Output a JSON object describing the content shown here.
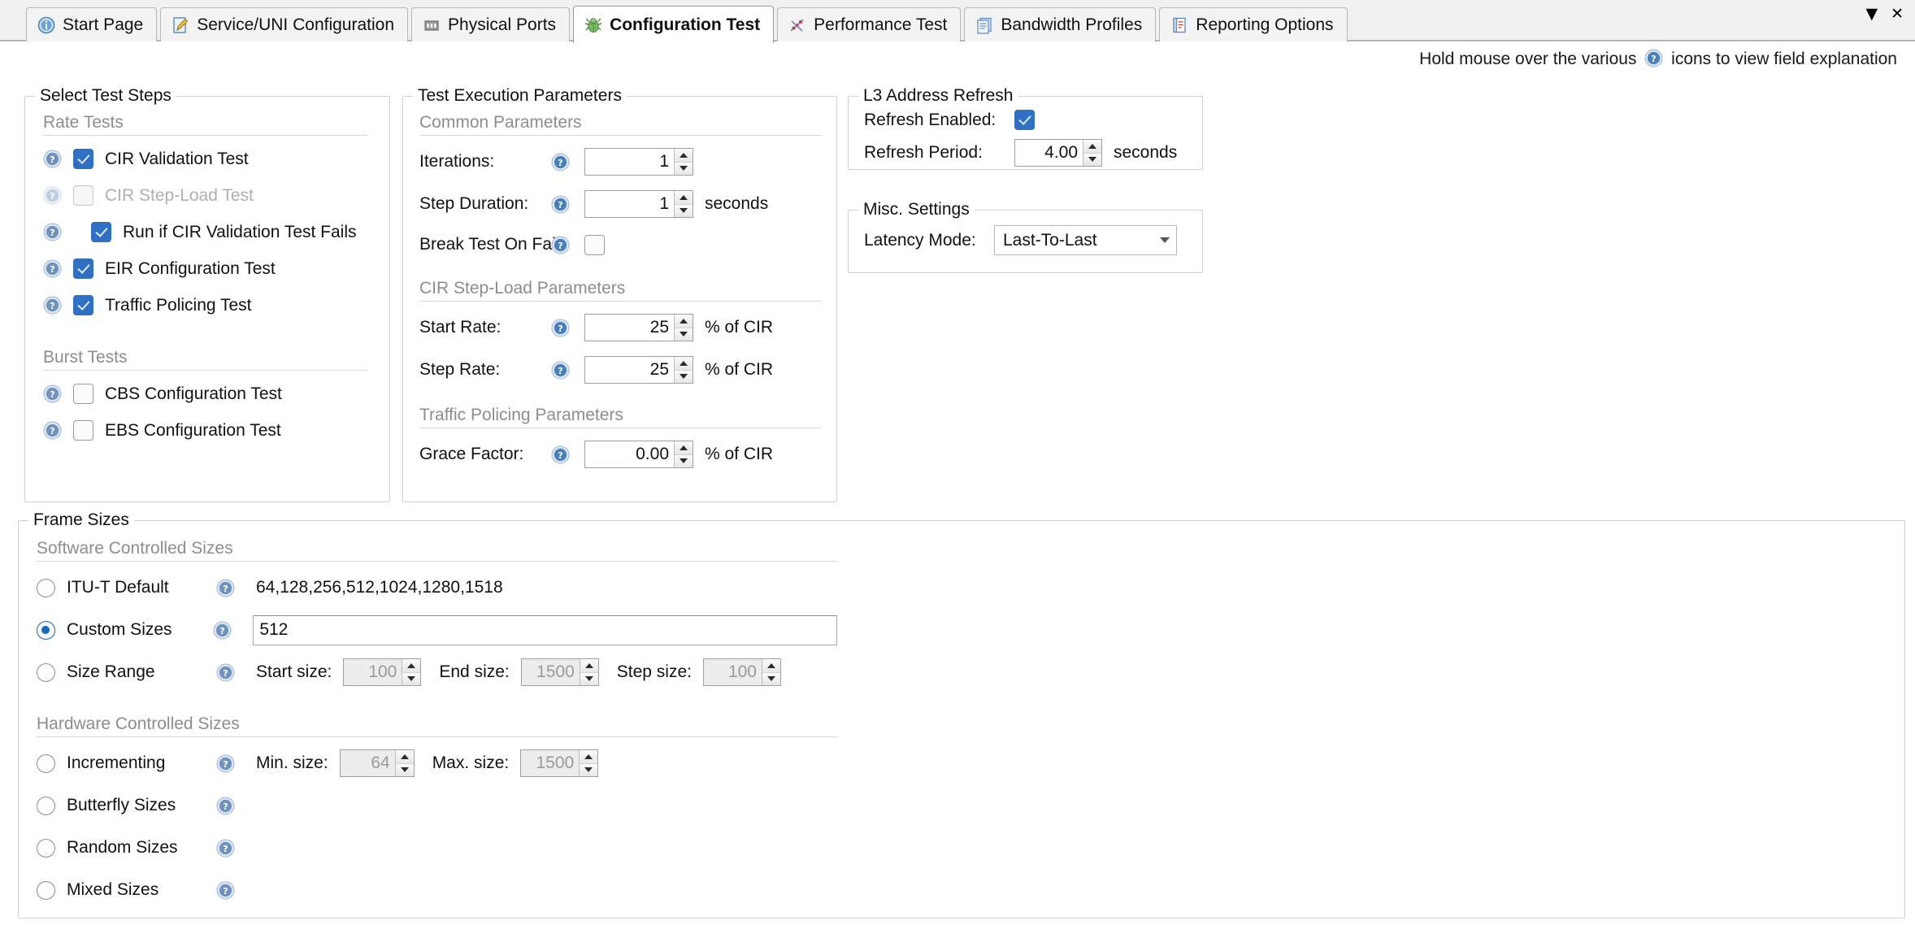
{
  "tabs": [
    {
      "label": "Start Page",
      "icon": "info-icon",
      "active": false
    },
    {
      "label": "Service/UNI Configuration",
      "icon": "pencil-document-icon",
      "active": false
    },
    {
      "label": "Physical Ports",
      "icon": "ports-icon",
      "active": false
    },
    {
      "label": "Configuration Test",
      "icon": "green-bug-icon",
      "active": true
    },
    {
      "label": "Performance Test",
      "icon": "scatter-chart-icon",
      "active": false
    },
    {
      "label": "Bandwidth Profiles",
      "icon": "documents-icon",
      "active": false
    },
    {
      "label": "Reporting Options",
      "icon": "report-icon",
      "active": false
    }
  ],
  "window_buttons": {
    "dropdown": "▼",
    "close": "✕"
  },
  "hint": {
    "before": "Hold mouse over the various",
    "after": "icons to view field explanation"
  },
  "select_test_steps": {
    "title": "Select Test Steps",
    "rate_tests_header": "Rate Tests",
    "burst_tests_header": "Burst Tests",
    "rate_tests": [
      {
        "label": "CIR Validation Test",
        "checked": true,
        "disabled": false,
        "indent": false
      },
      {
        "label": "CIR Step-Load Test",
        "checked": false,
        "disabled": true,
        "indent": false
      },
      {
        "label": "Run if CIR Validation Test Fails",
        "checked": true,
        "disabled": false,
        "indent": true
      },
      {
        "label": "EIR Configuration Test",
        "checked": true,
        "disabled": false,
        "indent": false
      },
      {
        "label": "Traffic Policing Test",
        "checked": true,
        "disabled": false,
        "indent": false
      }
    ],
    "burst_tests": [
      {
        "label": "CBS Configuration Test",
        "checked": false,
        "disabled": false,
        "indent": false
      },
      {
        "label": "EBS Configuration Test",
        "checked": false,
        "disabled": false,
        "indent": false
      }
    ]
  },
  "test_execution": {
    "title": "Test Execution Parameters",
    "common_header": "Common Parameters",
    "iterations": {
      "label": "Iterations:",
      "value": "1"
    },
    "step_duration": {
      "label": "Step Duration:",
      "value": "1",
      "units": "seconds"
    },
    "break_on_fail": {
      "label": "Break Test On Fail:",
      "checked": false
    },
    "cir_step_load_header": "CIR Step-Load Parameters",
    "start_rate": {
      "label": "Start Rate:",
      "value": "25",
      "units": "% of CIR"
    },
    "step_rate": {
      "label": "Step Rate:",
      "value": "25",
      "units": "% of CIR"
    },
    "traffic_policing_header": "Traffic Policing Parameters",
    "grace_factor": {
      "label": "Grace Factor:",
      "value": "0.00",
      "units": "% of CIR"
    }
  },
  "l3_refresh": {
    "title": "L3 Address Refresh",
    "refresh_enabled": {
      "label": "Refresh Enabled:",
      "checked": true
    },
    "refresh_period": {
      "label": "Refresh Period:",
      "value": "4.00",
      "units": "seconds"
    }
  },
  "misc_settings": {
    "title": "Misc. Settings",
    "latency_mode": {
      "label": "Latency Mode:",
      "value": "Last-To-Last"
    }
  },
  "frame_sizes": {
    "title": "Frame Sizes",
    "software_header": "Software Controlled Sizes",
    "hardware_header": "Hardware Controlled Sizes",
    "itut_default": {
      "label": "ITU-T Default",
      "selected": false,
      "values": "64,128,256,512,1024,1280,1518"
    },
    "custom_sizes": {
      "label": "Custom Sizes",
      "selected": true,
      "value": "512"
    },
    "size_range": {
      "label": "Size Range",
      "selected": false,
      "start_label": "Start size:",
      "start_value": "100",
      "end_label": "End size:",
      "end_value": "1500",
      "step_label": "Step size:",
      "step_value": "100"
    },
    "incrementing": {
      "label": "Incrementing",
      "selected": false,
      "min_label": "Min. size:",
      "min_value": "64",
      "max_label": "Max. size:",
      "max_value": "1500"
    },
    "butterfly": {
      "label": "Butterfly Sizes",
      "selected": false
    },
    "random": {
      "label": "Random Sizes",
      "selected": false
    },
    "mixed": {
      "label": "Mixed Sizes",
      "selected": false
    }
  },
  "colors": {
    "accent_blue": "#2f6fc4",
    "radio_blue": "#1666c4",
    "section_gray": "#8d8d8d",
    "border_gray": "#cfcfcf"
  }
}
